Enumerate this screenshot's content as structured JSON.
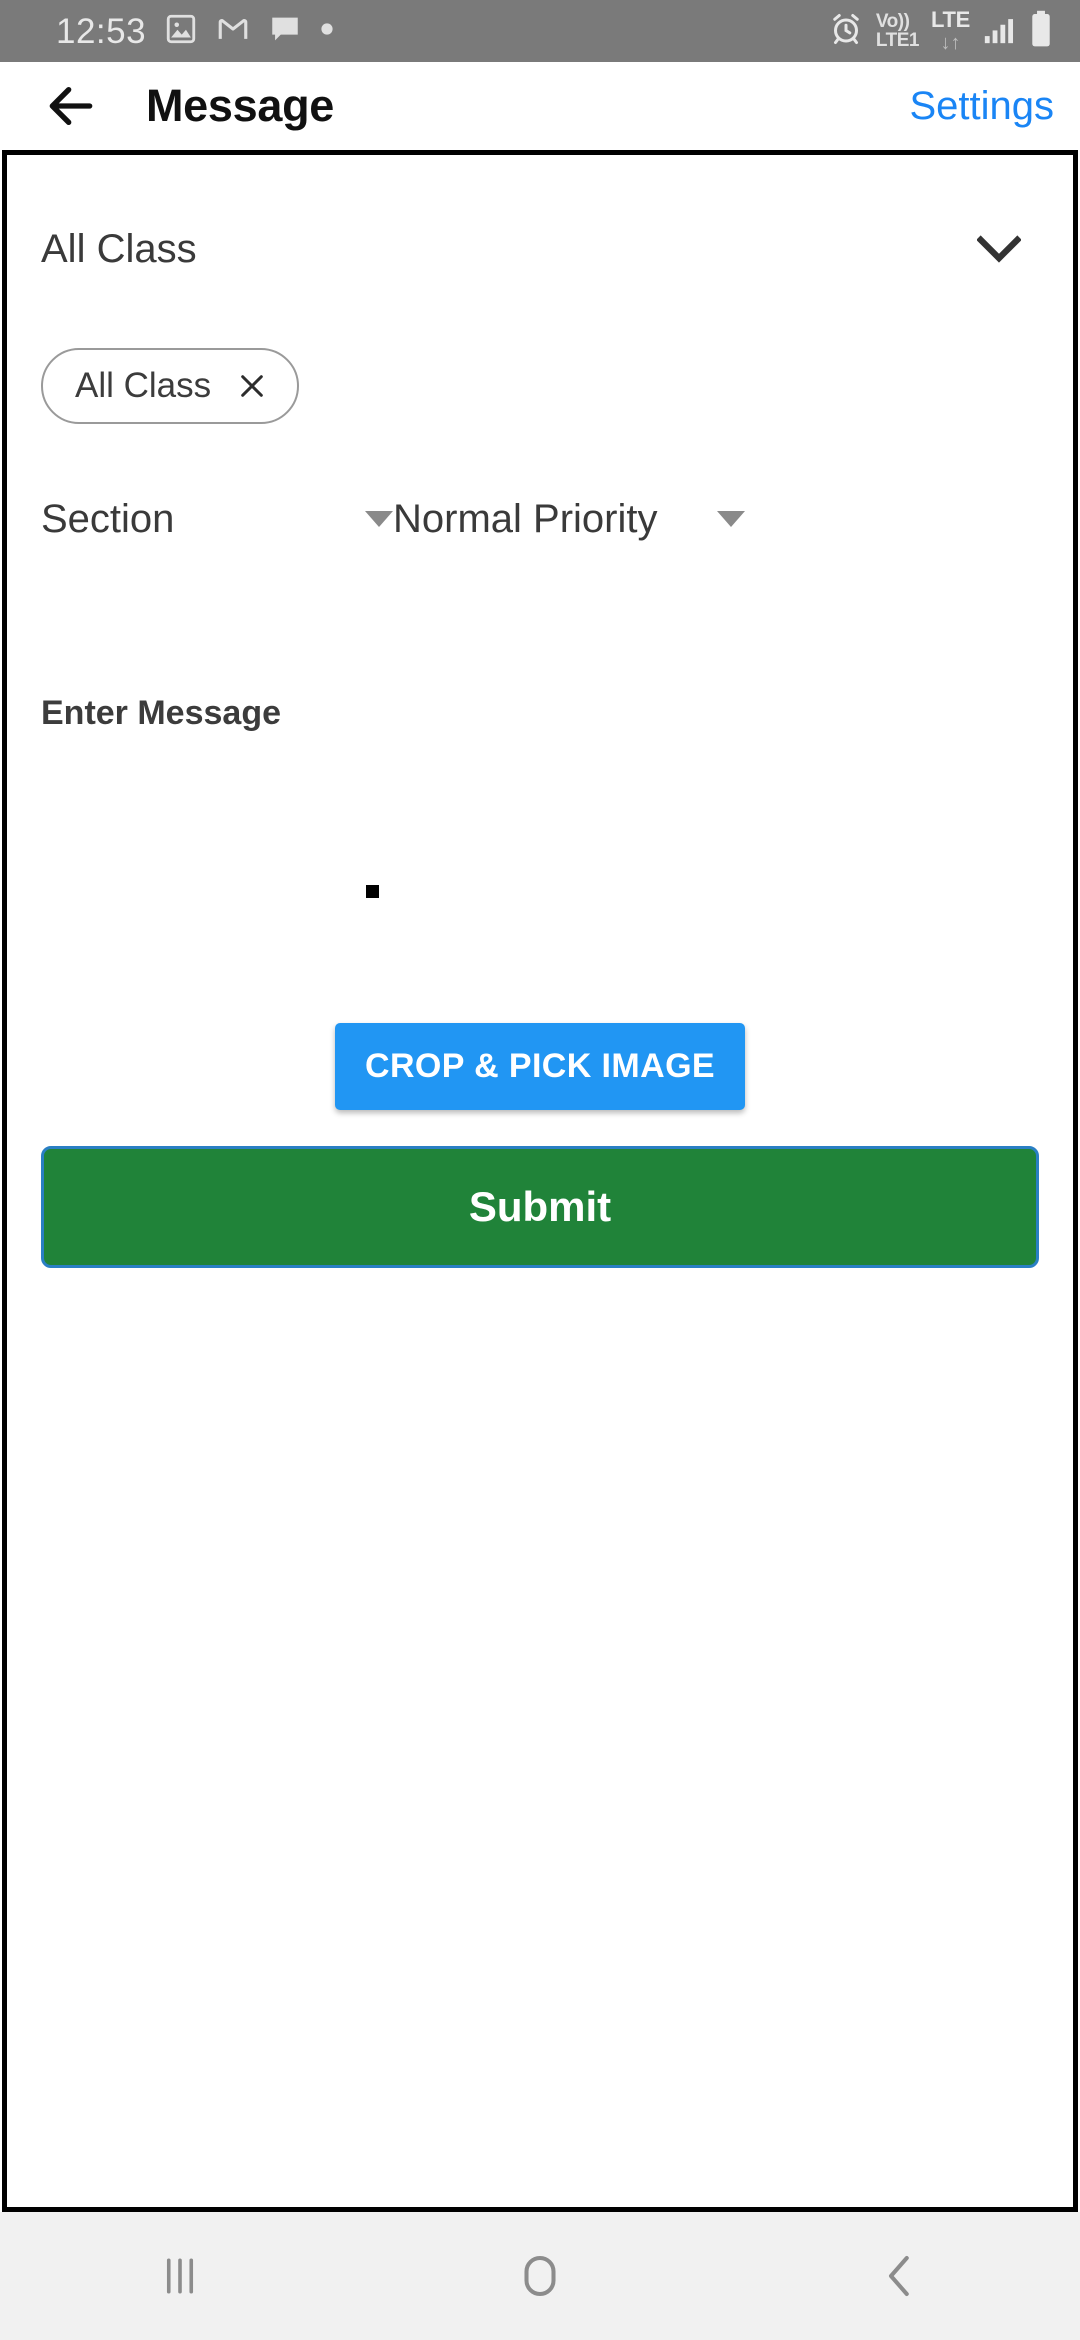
{
  "status_bar": {
    "time": "12:53",
    "left_icons": [
      "gallery-icon",
      "gmail-icon",
      "message-bubble-icon",
      "dot-icon"
    ],
    "volte_top": "Vo))",
    "volte_bottom": "LTE1",
    "network_type": "LTE",
    "data_arrows": "↓↑",
    "right_icons": [
      "alarm-icon",
      "volte-icon",
      "lte-icon",
      "signal-bars-icon",
      "battery-icon"
    ],
    "background_color": "#7a7a7a",
    "text_color": "#e8e8e8"
  },
  "app_bar": {
    "back_label": "back-arrow",
    "title": "Message",
    "settings_label": "Settings",
    "settings_color": "#1a85f5"
  },
  "form": {
    "class_dropdown": {
      "value": "All Class",
      "chevron": "chevron-down-icon"
    },
    "selected_chips": [
      {
        "label": "All Class",
        "close": "✕"
      }
    ],
    "section_spinner": {
      "value": "Section"
    },
    "priority_spinner": {
      "value": "Normal Priority"
    },
    "message_field": {
      "label": "Enter Message",
      "value": "",
      "placeholder": ""
    },
    "crop_button": {
      "label": "CROP & PICK IMAGE",
      "color": "#2196f3"
    },
    "submit_button": {
      "label": "Submit",
      "color": "#208339",
      "border_color": "#2a7fc4"
    }
  },
  "nav_bar": {
    "recents_label": "recents-icon",
    "home_label": "home-icon",
    "back_label": "back-icon",
    "background_color": "#f1f1f1"
  }
}
